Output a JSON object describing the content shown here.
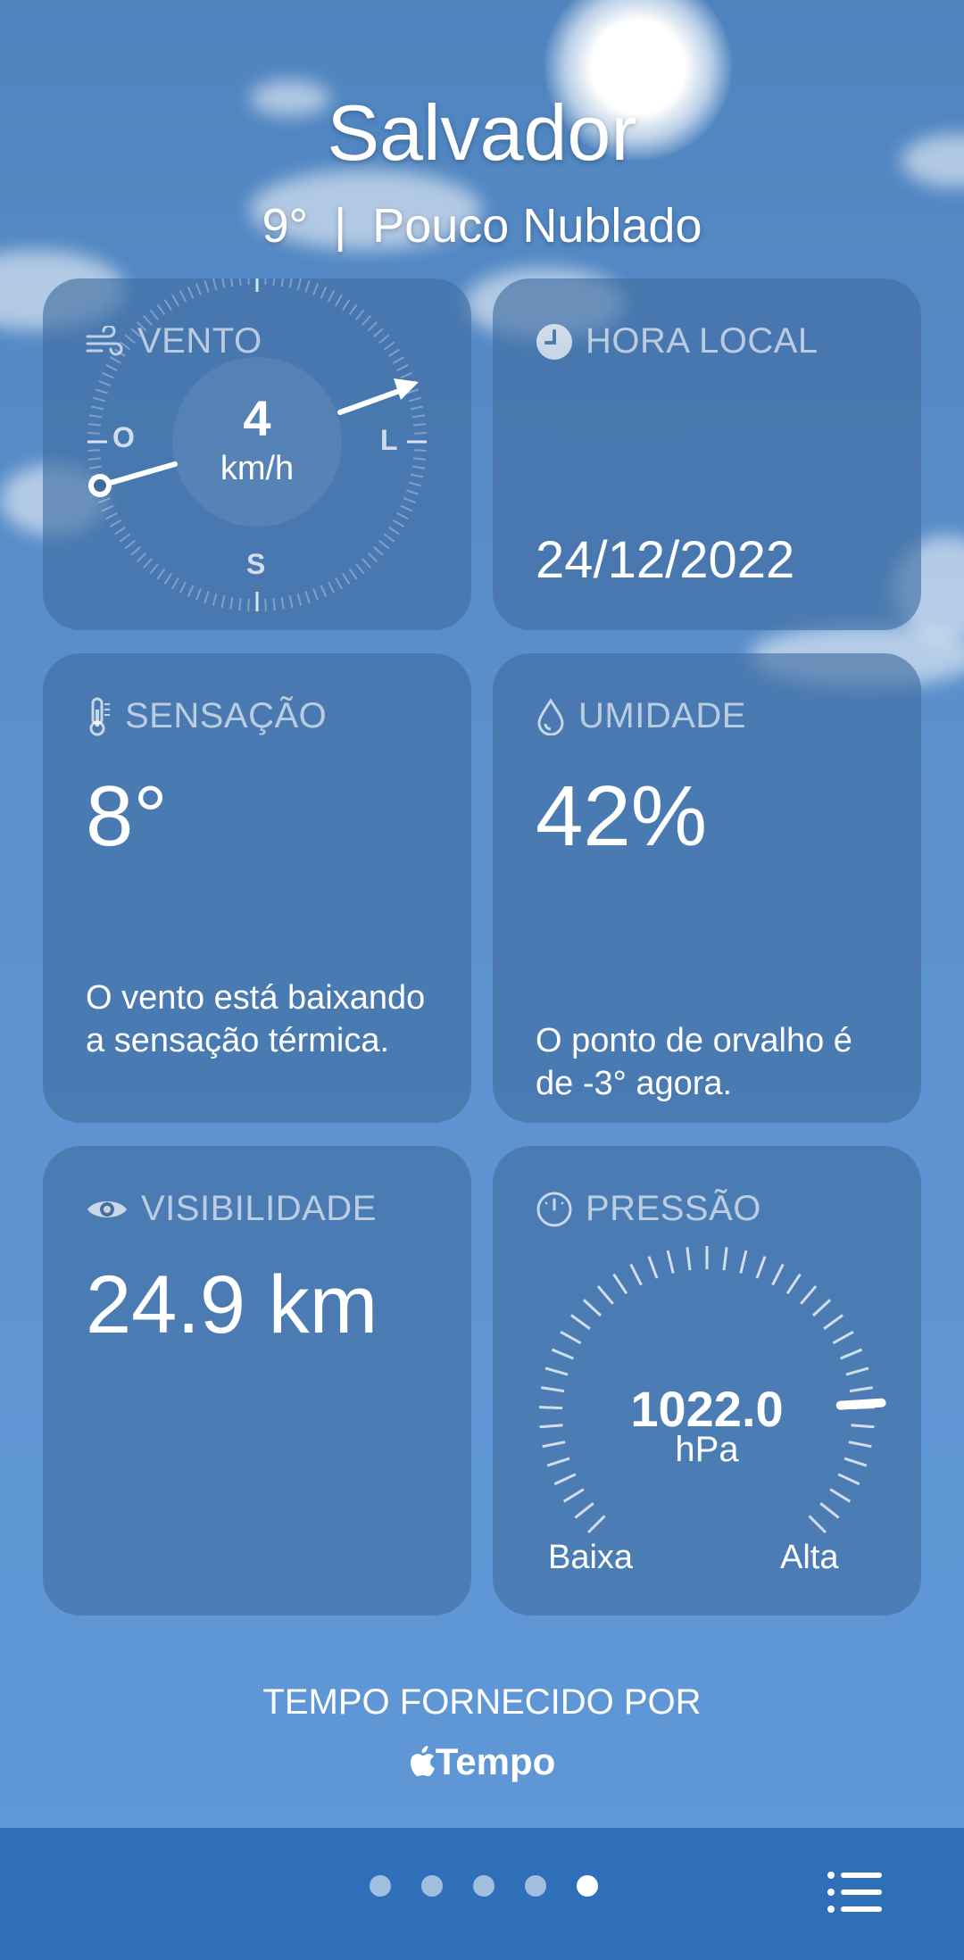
{
  "header": {
    "city": "Salvador",
    "temperature": "9°",
    "separator": "|",
    "condition": "Pouco Nublado"
  },
  "wind": {
    "title": "VENTO",
    "speed": "4",
    "unit": "km/h",
    "dir_west": "O",
    "dir_east": "L",
    "dir_south": "S",
    "icon": "wind-icon"
  },
  "local_time": {
    "title": "HORA LOCAL",
    "date": "24/12/2022",
    "icon": "clock-icon"
  },
  "feels_like": {
    "title": "SENSAÇÃO",
    "value": "8°",
    "note": "O vento está baixando a sensação térmica.",
    "icon": "thermometer-icon"
  },
  "humidity": {
    "title": "UMIDADE",
    "value": "42%",
    "note": "O ponto de orvalho é de -3° agora.",
    "icon": "droplet-icon"
  },
  "visibility": {
    "title": "VISIBILIDADE",
    "value": "24.9 km",
    "icon": "eye-icon"
  },
  "pressure": {
    "title": "PRESSÃO",
    "value": "1022.0",
    "unit": "hPa",
    "low_label": "Baixa",
    "high_label": "Alta",
    "icon": "gauge-icon",
    "level_fraction": 0.82
  },
  "footer": {
    "provided_by": "TEMPO FORNECIDO POR",
    "brand": "Tempo"
  },
  "nav": {
    "page_count": 5,
    "active_page": 5,
    "menu_icon": "list-icon"
  },
  "colors": {
    "card": "#3f6ca0",
    "bottom_bar": "#2f6fb9",
    "text": "#ffffff"
  }
}
